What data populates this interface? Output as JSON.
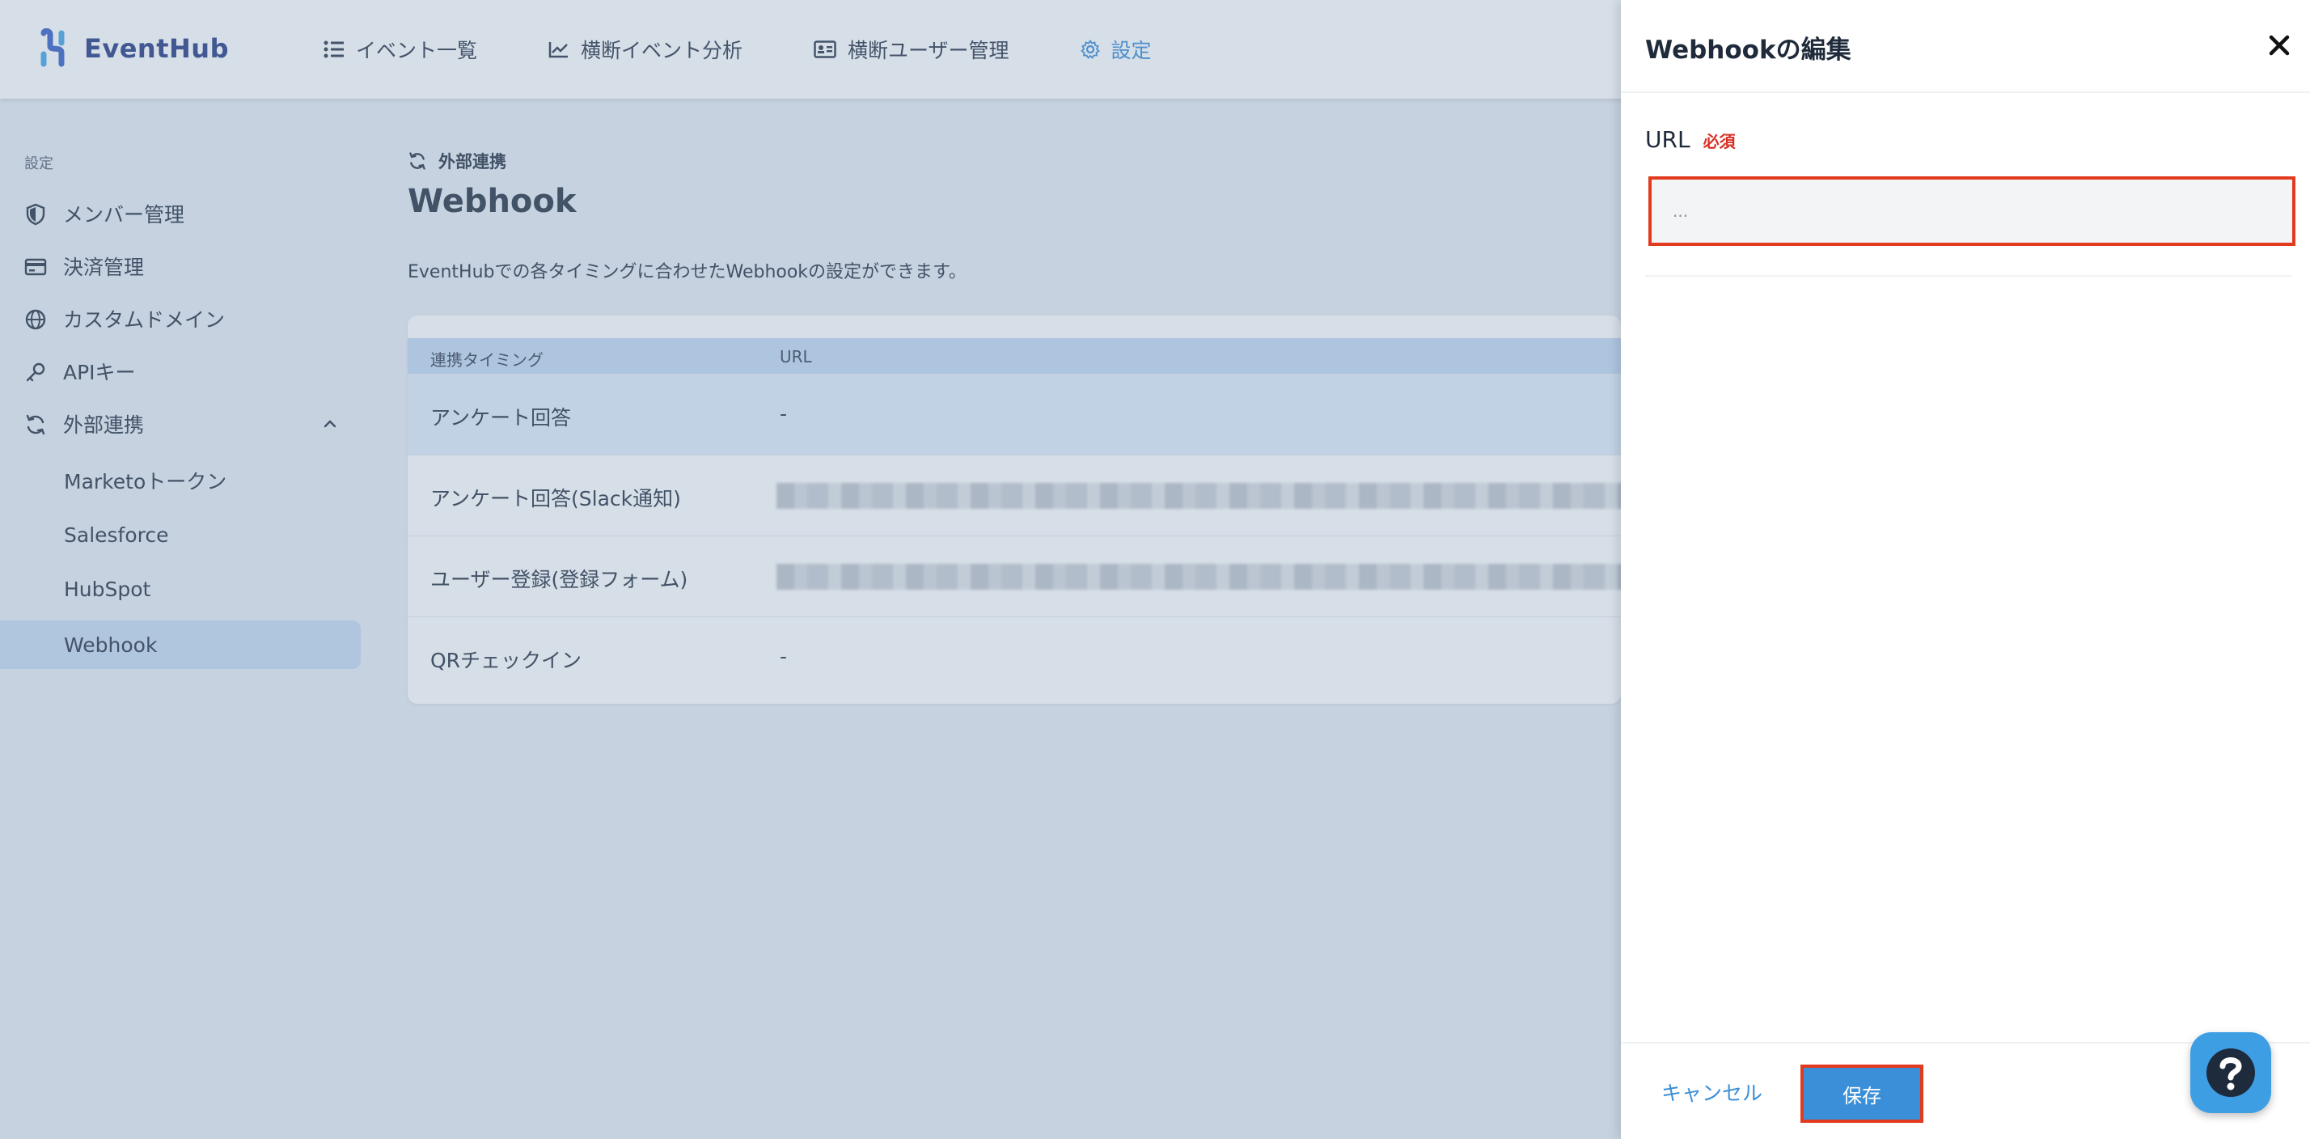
{
  "app": {
    "brand": "EventHub",
    "accent_color": "#3b8fd8",
    "nav": [
      {
        "label": "イベント一覧",
        "icon": "list-icon"
      },
      {
        "label": "横断イベント分析",
        "icon": "chart-line-icon"
      },
      {
        "label": "横断ユーザー管理",
        "icon": "id-card-icon"
      },
      {
        "label": "設定",
        "icon": "gear-icon",
        "active": true
      }
    ]
  },
  "sidebar": {
    "section_label": "設定",
    "items": [
      {
        "label": "メンバー管理",
        "icon": "shield-icon"
      },
      {
        "label": "決済管理",
        "icon": "credit-card-icon"
      },
      {
        "label": "カスタムドメイン",
        "icon": "globe-icon"
      },
      {
        "label": "APIキー",
        "icon": "key-icon"
      },
      {
        "label": "外部連携",
        "icon": "sync-icon",
        "expanded": true
      }
    ],
    "sub_items": [
      {
        "label": "Marketoトークン"
      },
      {
        "label": "Salesforce"
      },
      {
        "label": "HubSpot"
      },
      {
        "label": "Webhook",
        "active": true
      }
    ]
  },
  "main": {
    "breadcrumb": "外部連携",
    "title": "Webhook",
    "description": "EventHubでの各タイミングに合わせたWebhookの設定ができます。",
    "table": {
      "headers": [
        "連携タイミング",
        "URL"
      ],
      "rows": [
        {
          "timing": "アンケート回答",
          "url": "-",
          "highlighted": true
        },
        {
          "timing": "アンケート回答(Slack通知)",
          "url": "",
          "blurred": true
        },
        {
          "timing": "ユーザー登録(登録フォーム)",
          "url": "",
          "blurred": true
        },
        {
          "timing": "QRチェックイン",
          "url": "-"
        }
      ]
    }
  },
  "drawer": {
    "title": "Webhookの編集",
    "field_label": "URL",
    "required_label": "必須",
    "url_value": "",
    "url_placeholder": "...",
    "cancel_label": "キャンセル",
    "save_label": "保存",
    "highlight_color": "#e23a1e"
  }
}
